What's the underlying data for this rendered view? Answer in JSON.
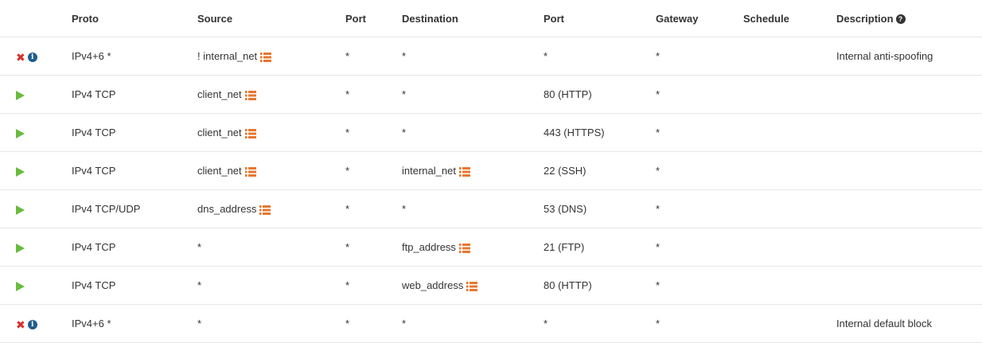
{
  "headers": {
    "icons": "",
    "proto": "Proto",
    "source": "Source",
    "source_port": "Port",
    "destination": "Destination",
    "dest_port": "Port",
    "gateway": "Gateway",
    "schedule": "Schedule",
    "description": "Description",
    "description_help_icon": "question-circle-icon"
  },
  "colors": {
    "pass": "#69bb3f",
    "block": "#d9302a",
    "info": "#1f5d8f",
    "alias": "#e8772e"
  },
  "rows": [
    {
      "action": "block",
      "proto": "IPv4+6 *",
      "source": "! internal_net",
      "source_alias": true,
      "source_port": "*",
      "destination": "*",
      "destination_alias": false,
      "dest_port": "*",
      "gateway": "*",
      "schedule": "",
      "description": "Internal anti-spoofing"
    },
    {
      "action": "pass",
      "proto": "IPv4 TCP",
      "source": "client_net",
      "source_alias": true,
      "source_port": "*",
      "destination": "*",
      "destination_alias": false,
      "dest_port": "80 (HTTP)",
      "gateway": "*",
      "schedule": "",
      "description": ""
    },
    {
      "action": "pass",
      "proto": "IPv4 TCP",
      "source": "client_net",
      "source_alias": true,
      "source_port": "*",
      "destination": "*",
      "destination_alias": false,
      "dest_port": "443 (HTTPS)",
      "gateway": "*",
      "schedule": "",
      "description": ""
    },
    {
      "action": "pass",
      "proto": "IPv4 TCP",
      "source": "client_net",
      "source_alias": true,
      "source_port": "*",
      "destination": "internal_net",
      "destination_alias": true,
      "dest_port": "22 (SSH)",
      "gateway": "*",
      "schedule": "",
      "description": ""
    },
    {
      "action": "pass",
      "proto": "IPv4 TCP/UDP",
      "source": "dns_address",
      "source_alias": true,
      "source_port": "*",
      "destination": "*",
      "destination_alias": false,
      "dest_port": "53 (DNS)",
      "gateway": "*",
      "schedule": "",
      "description": ""
    },
    {
      "action": "pass",
      "proto": "IPv4 TCP",
      "source": "*",
      "source_alias": false,
      "source_port": "*",
      "destination": "ftp_address",
      "destination_alias": true,
      "dest_port": "21 (FTP)",
      "gateway": "*",
      "schedule": "",
      "description": ""
    },
    {
      "action": "pass",
      "proto": "IPv4 TCP",
      "source": "*",
      "source_alias": false,
      "source_port": "*",
      "destination": "web_address",
      "destination_alias": true,
      "dest_port": "80 (HTTP)",
      "gateway": "*",
      "schedule": "",
      "description": ""
    },
    {
      "action": "block",
      "proto": "IPv4+6 *",
      "source": "*",
      "source_alias": false,
      "source_port": "*",
      "destination": "*",
      "destination_alias": false,
      "dest_port": "*",
      "gateway": "*",
      "schedule": "",
      "description": "Internal default block"
    }
  ]
}
